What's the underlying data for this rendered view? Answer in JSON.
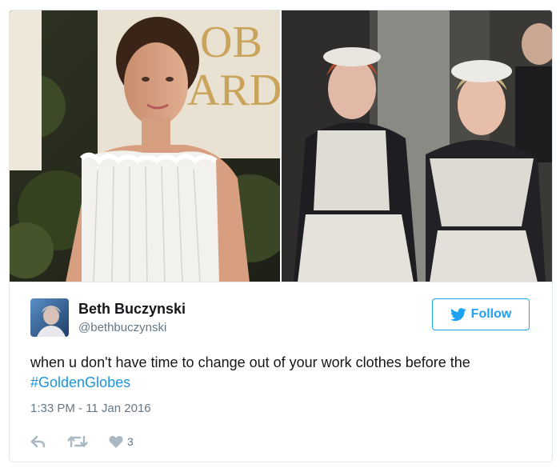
{
  "media": {
    "left_photo": "golden-globes-red-carpet-photo",
    "right_photo": "maid-uniform-film-still-photo",
    "backdrop_text": "OB ARD"
  },
  "user": {
    "display_name": "Beth Buczynski",
    "handle": "@bethbuczynski"
  },
  "follow_button": {
    "label": "Follow"
  },
  "tweet": {
    "text": "when u don't have time to change out of your work clothes before the ",
    "hashtag": "#GoldenGlobes",
    "timestamp": "1:33 PM - 11 Jan 2016"
  },
  "actions": {
    "reply_icon": "reply-icon",
    "retweet_icon": "retweet-icon",
    "like_icon": "heart-icon",
    "like_count": "3"
  },
  "colors": {
    "accent": "#1da1f2",
    "link": "#1b95e0",
    "text": "#14171a",
    "muted": "#657786",
    "action_icon": "#aab8c2",
    "border": "#e1e8ed"
  }
}
